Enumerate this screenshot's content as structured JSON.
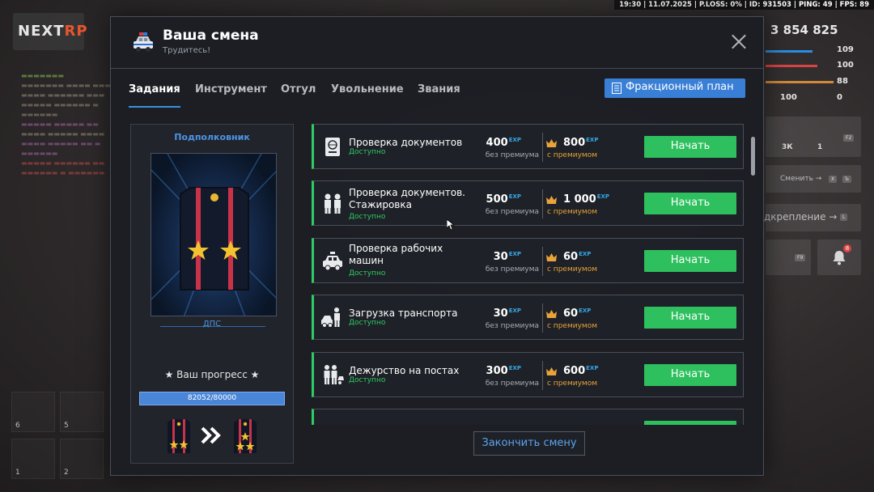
{
  "hud": {
    "topbar": "19:30 | 11.07.2025 | P.LOSS: 0% | ID: 931503 | PING: 49 | FPS: 89",
    "logo_text_a": "NEXT",
    "logo_text_b": "RP",
    "money": "3 854 825",
    "stats": [
      "109",
      "100",
      "88",
      "100",
      "0"
    ],
    "inventory": [
      "3К",
      "1"
    ],
    "key_f2": "F2",
    "key_f9": "F9",
    "switch_label": "Сменить →",
    "switch_keys": [
      "X",
      "Ъ"
    ],
    "support_label": "дкрепление →",
    "support_key": "L",
    "notification_count": "8",
    "slot_numbers": [
      "6",
      "1",
      "5",
      "2"
    ]
  },
  "modal": {
    "title": "Ваша смена",
    "subtitle": "Трудитесь!",
    "tabs": [
      {
        "label": "Задания",
        "active": true
      },
      {
        "label": "Инструмент",
        "active": false
      },
      {
        "label": "Отгул",
        "active": false
      },
      {
        "label": "Увольнение",
        "active": false
      },
      {
        "label": "Звания",
        "active": false
      }
    ],
    "plan_button": "Фракционный план",
    "end_shift_button": "Закончить смену"
  },
  "rank": {
    "name": "Подполковник",
    "department": "ДПС",
    "progress_label": "★ Ваш прогресс ★",
    "progress_text": "82052/80000",
    "progress_fraction": 1.0
  },
  "tasks": [
    {
      "title": "Проверка документов",
      "status": "Доступно",
      "base": "400",
      "premium": "800",
      "base_caption": "без премиума",
      "premium_caption": "с премиумом",
      "exp": "EXP",
      "button": "Начать",
      "icon": "passport-icon"
    },
    {
      "title": "Проверка документов. Стажировка",
      "status": "Доступно",
      "base": "500",
      "premium": "1 000",
      "base_caption": "без премиума",
      "premium_caption": "с премиумом",
      "exp": "EXP",
      "button": "Начать",
      "icon": "officers-icon"
    },
    {
      "title": "Проверка рабочих машин",
      "status": "Доступно",
      "base": "30",
      "premium": "60",
      "base_caption": "без премиума",
      "premium_caption": "с премиумом",
      "exp": "EXP",
      "button": "Начать",
      "icon": "police-car-icon"
    },
    {
      "title": "Загрузка транспорта",
      "status": "Доступно",
      "base": "30",
      "premium": "60",
      "base_caption": "без премиума",
      "premium_caption": "с премиумом",
      "exp": "EXP",
      "button": "Начать",
      "icon": "tow-truck-icon"
    },
    {
      "title": "Дежурство на постах",
      "status": "Доступно",
      "base": "300",
      "premium": "600",
      "base_caption": "без премиума",
      "premium_caption": "с премиумом",
      "exp": "EXP",
      "button": "Начать",
      "icon": "patrol-post-icon"
    }
  ],
  "colors": {
    "accent_blue": "#3a7fd6",
    "start_green": "#2ec05e",
    "premium_orange": "#e8a33a",
    "exp_blue": "#35a8e8"
  }
}
